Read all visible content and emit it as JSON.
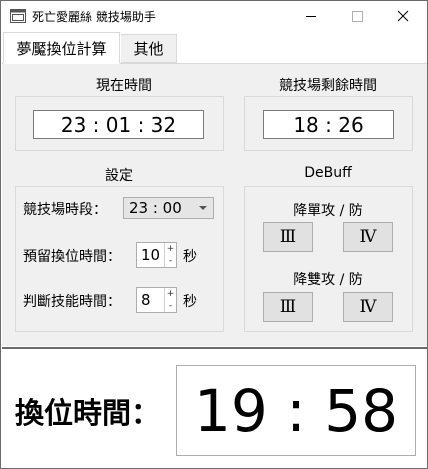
{
  "window": {
    "title": "死亡愛麗絲 競技場助手"
  },
  "tabs": [
    {
      "label": "夢魘換位計算",
      "selected": true
    },
    {
      "label": "其他",
      "selected": false
    }
  ],
  "current_time": {
    "label": "現在時間",
    "value": "23 : 01 : 32"
  },
  "arena_remaining": {
    "label": "競技場剩餘時間",
    "value": "18 : 26"
  },
  "settings": {
    "label": "設定",
    "arena_period_label": "競技場時段：",
    "arena_period_value": "23 : 00",
    "reserve_label": "預留換位時間：",
    "reserve_value": "10",
    "reserve_unit": "秒",
    "skill_label": "判斷技能時間：",
    "skill_value": "8",
    "skill_unit": "秒",
    "step_up": "+",
    "step_down": "-"
  },
  "debuff": {
    "label": "DeBuff",
    "single_label": "降單攻 / 防",
    "single_buttons": [
      "Ⅲ",
      "Ⅳ"
    ],
    "double_label": "降雙攻 / 防",
    "double_buttons": [
      "Ⅲ",
      "Ⅳ"
    ]
  },
  "swap": {
    "label": "換位時間：",
    "value": "19 : 58"
  },
  "colors": {
    "panel_bg": "#f0f0f0",
    "border": "#d9d9d9",
    "button_bg": "#e1e1e1"
  }
}
